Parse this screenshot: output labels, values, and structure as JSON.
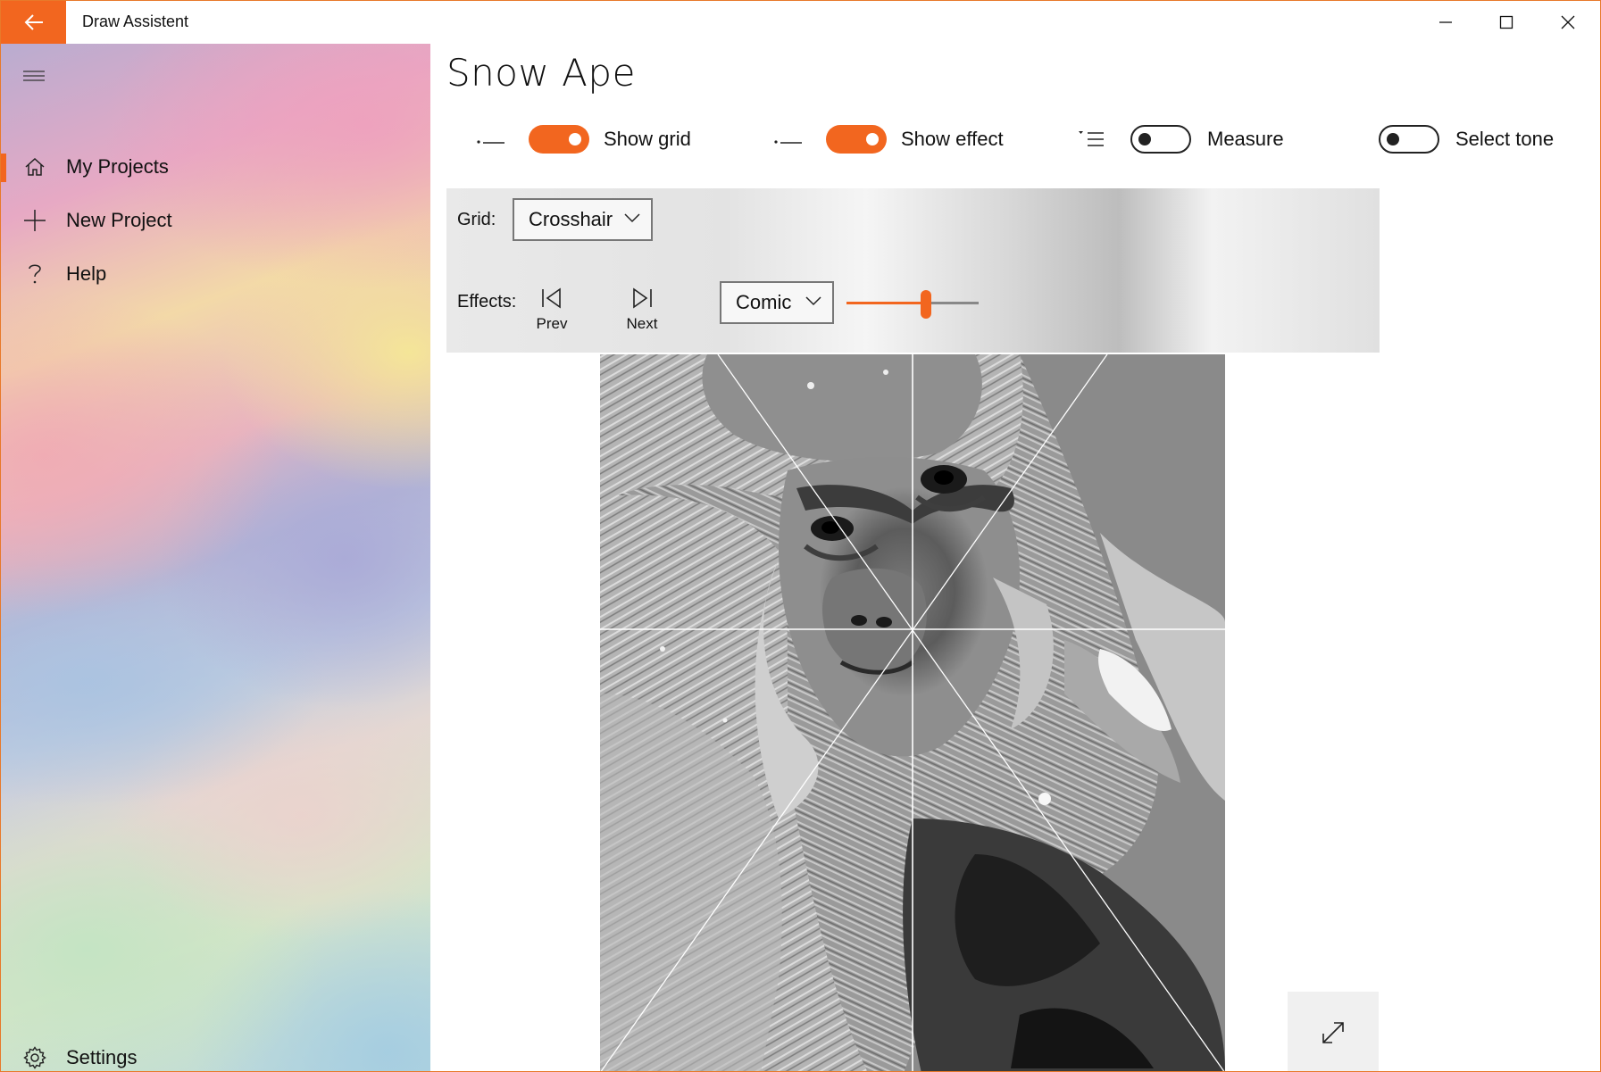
{
  "window": {
    "title": "Draw Assistent",
    "accent_color": "#f2661f"
  },
  "sidebar": {
    "items": [
      {
        "label": "My Projects",
        "icon": "home-icon",
        "active": true
      },
      {
        "label": "New Project",
        "icon": "plus-icon",
        "active": false
      },
      {
        "label": "Help",
        "icon": "question-icon",
        "active": false
      }
    ],
    "footer": {
      "label": "Settings",
      "icon": "gear-icon"
    }
  },
  "main": {
    "title": "Snow Ape",
    "toggles": [
      {
        "label": "Show grid",
        "on": true,
        "icon": "collapse-icon"
      },
      {
        "label": "Show effect",
        "on": true,
        "icon": "collapse-icon"
      },
      {
        "label": "Measure",
        "on": false,
        "icon": "list-options-icon"
      },
      {
        "label": "Select tone",
        "on": false,
        "icon": ""
      }
    ],
    "grid": {
      "label": "Grid:",
      "selected": "Crosshair"
    },
    "effects": {
      "label": "Effects:",
      "prev_label": "Prev",
      "next_label": "Next",
      "selected": "Comic",
      "slider_value": 0.6
    },
    "image": {
      "description_icon": "photo-image"
    },
    "fullscreen_icon": "expand-icon"
  }
}
